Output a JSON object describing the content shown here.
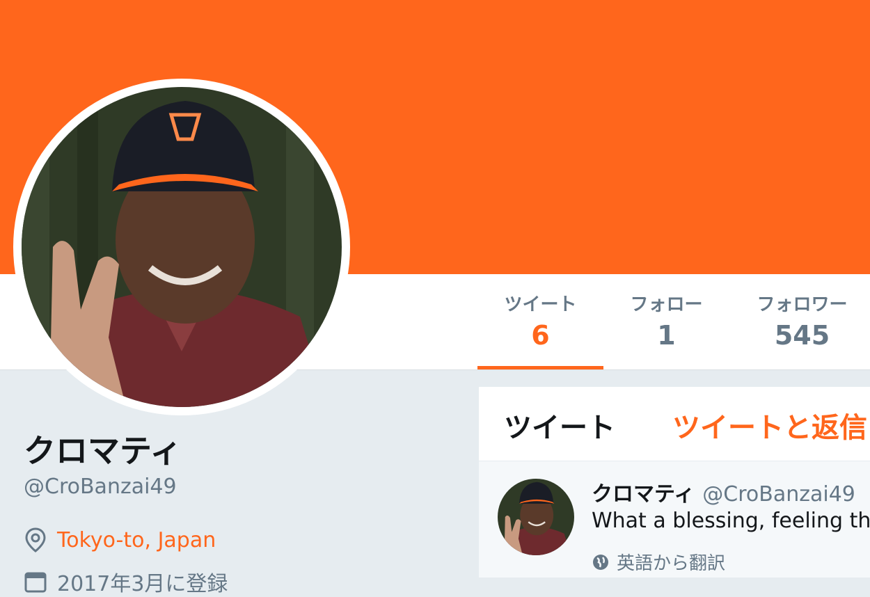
{
  "profile": {
    "name": "クロマティ",
    "handle": "@CroBanzai49",
    "location": "Tokyo-to, Japan",
    "joined": "2017年3月に登録"
  },
  "stats": [
    {
      "label": "ツイート",
      "value": "6"
    },
    {
      "label": "フォロー",
      "value": "1"
    },
    {
      "label": "フォロワー",
      "value": "545"
    }
  ],
  "timeline": {
    "tabs": [
      "ツイート",
      "ツイートと返信"
    ],
    "tweet": {
      "name": "クロマティ",
      "handle": "@CroBanzai49",
      "text": "What a blessing, feeling the",
      "translate": "英語から翻訳"
    }
  },
  "colors": {
    "accent": "#ff661c",
    "secondary": "#657786"
  },
  "icons": [
    "location-pin-icon",
    "calendar-icon",
    "globe-icon"
  ]
}
